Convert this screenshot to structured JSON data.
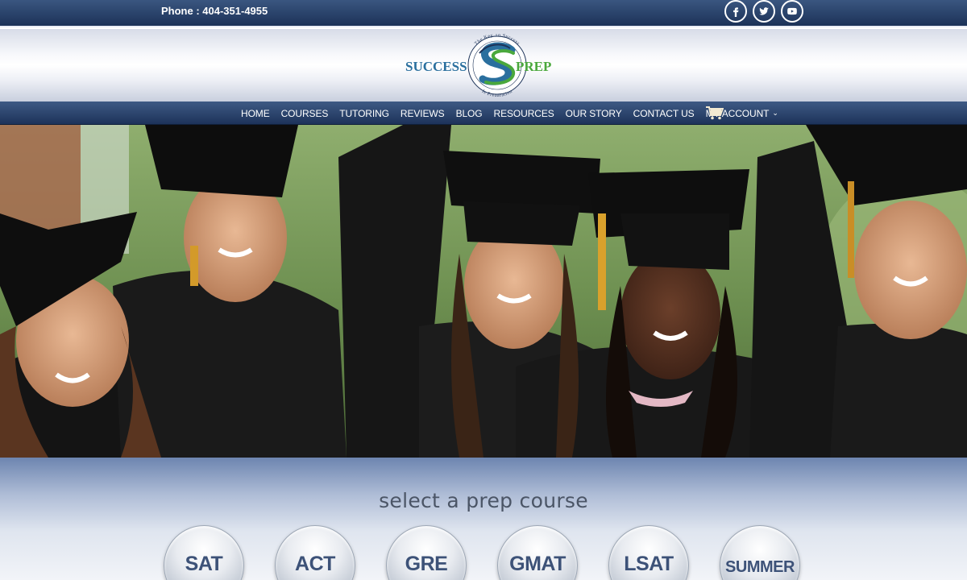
{
  "topbar": {
    "phone": "Phone : 404-351-4955",
    "socials": [
      {
        "icon": "facebook-icon"
      },
      {
        "icon": "twitter-icon"
      },
      {
        "icon": "youtube-icon"
      }
    ]
  },
  "logo": {
    "word_left": "SUCCESS",
    "word_right": "PREP",
    "ring_top": "The Key To Success",
    "ring_bottom": "Is Preparation",
    "monogram": "S"
  },
  "nav": {
    "items": [
      {
        "label": "HOME"
      },
      {
        "label": "COURSES"
      },
      {
        "label": "TUTORING"
      },
      {
        "label": "REVIEWS"
      },
      {
        "label": "BLOG"
      },
      {
        "label": "RESOURCES"
      },
      {
        "label": "OUR STORY"
      },
      {
        "label": "CONTACT US"
      },
      {
        "label": "MY ACCOUNT"
      }
    ],
    "cart_icon": "shopping-cart-icon"
  },
  "courses": {
    "heading": "select a prep course",
    "buttons": [
      {
        "label": "SAT"
      },
      {
        "label": "ACT"
      },
      {
        "label": "GRE"
      },
      {
        "label": "GMAT"
      },
      {
        "label": "LSAT"
      },
      {
        "label": "SUMMER"
      }
    ]
  },
  "colors": {
    "navy": "#1c3258",
    "course_text": "#3d5278",
    "logo_blue": "#2a6f9e",
    "logo_green": "#4aa83c"
  }
}
